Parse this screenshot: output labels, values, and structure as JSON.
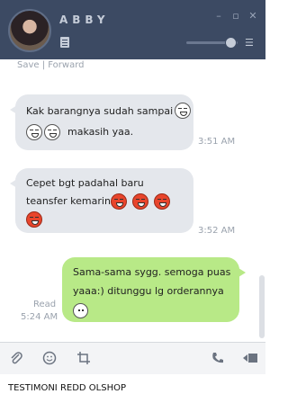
{
  "header": {
    "contact_name": "ABBY",
    "window_controls": [
      "minimize-icon",
      "restore-icon",
      "close-icon"
    ]
  },
  "chat": {
    "save_forward": "Save | Forward",
    "messages": [
      {
        "direction": "in",
        "line1": "Kak barangnya sudah sampai",
        "line2": "makasih yaa.",
        "time": "3:51 AM"
      },
      {
        "direction": "in",
        "line1": "Cepet bgt padahal baru",
        "line2": "teansfer kemarin",
        "time": "3:52 AM"
      },
      {
        "direction": "out",
        "line1": "Sama-sama sygg. semoga puas",
        "line2": "yaaa:) ditunggu lg orderannya",
        "status": "Read",
        "time": "5:24 AM"
      }
    ]
  },
  "toolbar": {
    "icons": [
      "attach-icon",
      "emoji-icon",
      "crop-icon",
      "call-icon",
      "video-call-icon"
    ]
  },
  "caption": "TESTIMONI REDD OLSHOP",
  "colors": {
    "header": "#3c4a63",
    "bubble_in": "#e4e7ec",
    "bubble_out": "#b8e987"
  }
}
